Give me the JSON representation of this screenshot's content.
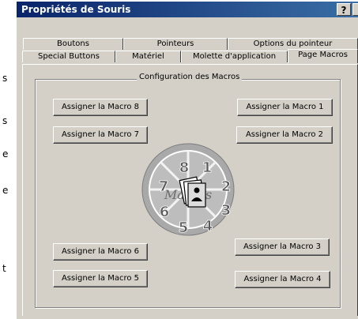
{
  "outside_letters": [
    "s",
    "s",
    "e",
    "e",
    "t"
  ],
  "window": {
    "title": "Propriétés de Souris",
    "help_label": "?"
  },
  "tabs": {
    "row1": [
      "Boutons",
      "Pointeurs",
      "Options du pointeur"
    ],
    "row2": [
      "Special Buttons",
      "Matériel",
      "Molette d'application",
      "Page Macros"
    ]
  },
  "group": {
    "title": "Configuration des Macros"
  },
  "buttons": {
    "macro1": "Assigner la Macro 1",
    "macro2": "Assigner la Macro 2",
    "macro3": "Assigner la Macro 3",
    "macro4": "Assigner la Macro 4",
    "macro5": "Assigner la Macro 5",
    "macro6": "Assigner la Macro 6",
    "macro7": "Assigner la Macro 7",
    "macro8": "Assigner la Macro 8"
  },
  "wheel": {
    "segments": [
      "1",
      "2",
      "3",
      "4",
      "5",
      "6",
      "7",
      "8"
    ],
    "logo_text": "Macros"
  }
}
